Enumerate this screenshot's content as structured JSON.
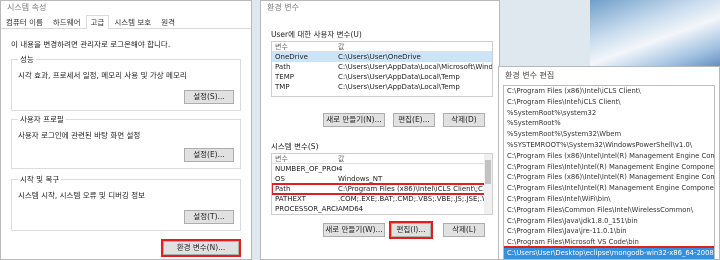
{
  "sysprops": {
    "title": "시스템 속성",
    "tabs": [
      "컴퓨터 이름",
      "하드웨어",
      "고급",
      "시스템 보호",
      "원격"
    ],
    "note": "이 내용을 변경하려면 관리자로 로그온해야 합니다.",
    "performance": {
      "title": "성능",
      "desc": "시각 효과, 프로세서 일정, 메모리 사용 및 가상 메모리",
      "button": "설정(S)..."
    },
    "profile": {
      "title": "사용자 프로필",
      "desc": "사용자 로그인에 관련된 바탕 화면 설정",
      "button": "설정(E)..."
    },
    "startup": {
      "title": "시작 및 복구",
      "desc": "시스템 시작, 시스템 오류 및 디버깅 정보",
      "button": "설정(T)..."
    },
    "env_button": "환경 변수(N)..."
  },
  "envvars": {
    "title": "환경 변수",
    "user_section": "User에 대한 사용자 변수(U)",
    "columns": [
      "변수",
      "값"
    ],
    "user_rows": [
      {
        "name": "OneDrive",
        "value": "C:\\Users\\User\\OneDrive"
      },
      {
        "name": "Path",
        "value": "C:\\Users\\User\\AppData\\Local\\Microsoft\\WindowsApps;"
      },
      {
        "name": "TEMP",
        "value": "C:\\Users\\User\\AppData\\Local\\Temp"
      },
      {
        "name": "TMP",
        "value": "C:\\Users\\User\\AppData\\Local\\Temp"
      }
    ],
    "user_buttons": [
      "새로 만들기(N)...",
      "편집(E)...",
      "삭제(D)"
    ],
    "sys_section": "시스템 변수(S)",
    "sys_rows": [
      {
        "name": "NUMBER_OF_PROC...",
        "value": "4"
      },
      {
        "name": "OS",
        "value": "Windows_NT"
      },
      {
        "name": "Path",
        "value": "C:\\Program Files (x86)\\Intel\\iCLS Client\\;C:\\..."
      },
      {
        "name": "PATHEXT",
        "value": ".COM;.EXE;.BAT;.CMD;.VBS;.VBE;.JS;.JSE;.WSF;..."
      },
      {
        "name": "PROCESSOR_ARCH...",
        "value": "AMD64"
      }
    ],
    "sys_buttons": [
      "새로 만들기(W)...",
      "편집(I)...",
      "삭제(L)"
    ]
  },
  "editenv": {
    "title": "환경 변수 편집",
    "items": [
      "C:\\Program Files (x86)\\Intel\\iCLS Client\\",
      "C:\\Program Files\\Intel\\iCLS Client\\",
      "%SystemRoot%\\system32",
      "%SystemRoot%",
      "%SystemRoot%\\System32\\Wbem",
      "%SYSTEMROOT%\\System32\\WindowsPowerShell\\v1.0\\",
      "C:\\Program Files (x86)\\Intel\\Intel(R) Management Engine Components\\DAL",
      "C:\\Program Files\\Intel\\Intel(R) Management Engine Components\\DAL",
      "C:\\Program Files (x86)\\Intel\\Intel(R) Management Engine Components\\IPT",
      "C:\\Program Files\\Intel\\Intel(R) Management Engine Components\\IPT",
      "C:\\Program Files\\Intel\\WiFi\\bin\\",
      "C:\\Program Files\\Common Files\\Intel\\WirelessCommon\\",
      "C:\\Program Files\\Java\\jdk1.8.0_151\\bin",
      "C:\\Program Files\\Java\\jre-11.0.1\\bin",
      "C:\\Program Files\\Microsoft VS Code\\bin",
      "C:\\Users\\User\\Desktop\\eclipse\\mongodb-win32-x86_64-2008plus-s..."
    ],
    "selected_index": 15
  }
}
